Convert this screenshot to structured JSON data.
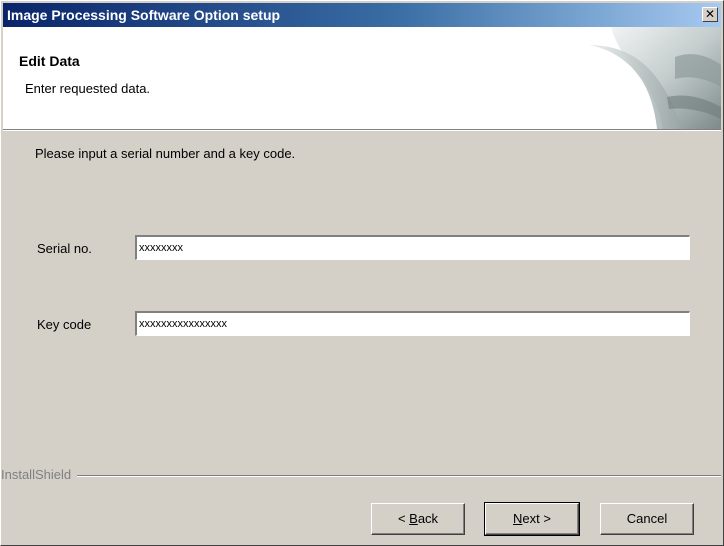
{
  "window": {
    "title": "Image Processing Software Option setup",
    "close_glyph": "✕"
  },
  "header": {
    "title": "Edit Data",
    "subtitle": "Enter requested data."
  },
  "main": {
    "instructions": "Please input a serial number and a key code.",
    "serial": {
      "label": "Serial no.",
      "value": "xxxxxxxx"
    },
    "keycode": {
      "label": "Key code",
      "value": "xxxxxxxxxxxxxxxx"
    }
  },
  "footer": {
    "brand": "InstallShield",
    "back_prefix": "< ",
    "back_mnemonic": "B",
    "back_rest": "ack",
    "next_mnemonic": "N",
    "next_rest": "ext >",
    "cancel_label": "Cancel"
  },
  "colors": {
    "title_gradient_start": "#0a246a",
    "title_gradient_end": "#a6caf0",
    "dialog_face": "#d4d0c8"
  }
}
